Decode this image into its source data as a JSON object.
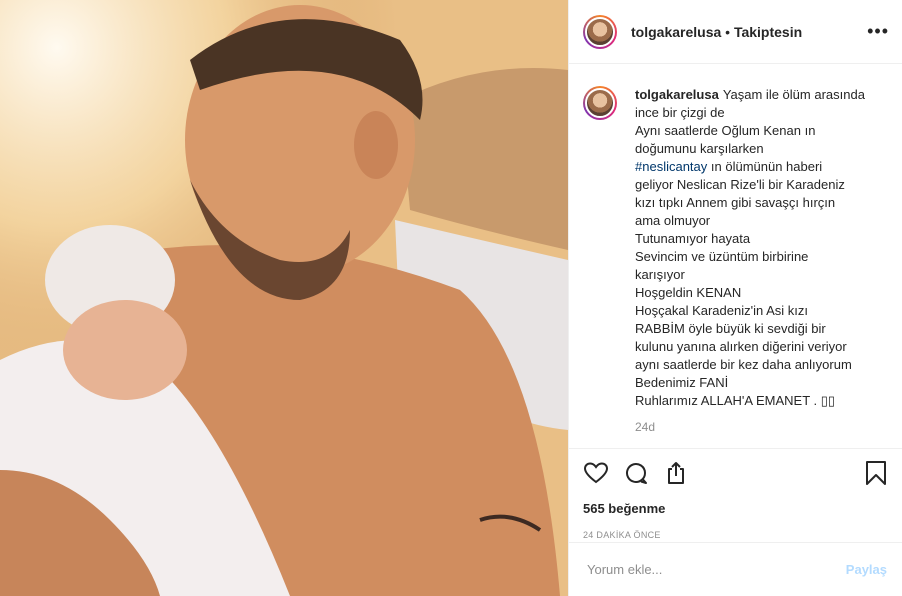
{
  "header": {
    "username": "tolgakarelusa",
    "separator": "•",
    "follow_status": "Takiptesin",
    "more_icon": "more-options-icon"
  },
  "caption": {
    "username": "tolgakarelusa",
    "line1": "Yaşam ile ölüm arasında",
    "line2": "ince bir çizgi de",
    "line3": "Aynı saatlerde Oğlum Kenan ın",
    "line4": "doğumunu karşılarken",
    "hashtag": "#neslicantay",
    "line5_rest": " ın ölümünün haberi",
    "line6": "geliyor Neslican Rize'li bir Karadeniz",
    "line7": "kızı tıpkı Annem gibi savaşçı hırçın",
    "line8": "ama olmuyor",
    "line9": "Tutunamıyor hayata",
    "line10": "Sevincim ve üzüntüm birbirine",
    "line11": "karışıyor",
    "line12": "Hoşgeldin KENAN",
    "line13": "Hoşçakal Karadeniz'in Asi kızı",
    "line14": "RABBİM öyle büyük ki sevdiği bir",
    "line15": "kulunu yanına alırken diğerini veriyor",
    "line16": "aynı saatlerde bir kez daha anlıyorum",
    "line17": "Bedenimiz FANİ",
    "line18": "Ruhlarımız ALLAH'A EMANET . ▯▯",
    "time": "24d"
  },
  "actions": {
    "icons": [
      "heart-icon",
      "comment-icon",
      "share-icon",
      "bookmark-icon"
    ],
    "likes": "565 beğenme",
    "posted": "24 DAKİKA ÖNCE"
  },
  "comment_box": {
    "placeholder": "Yorum ekle...",
    "post_label": "Paylaş"
  },
  "colors": {
    "hashtag": "#00376b",
    "post_disabled": "#b3dbff",
    "border": "#efefef"
  }
}
